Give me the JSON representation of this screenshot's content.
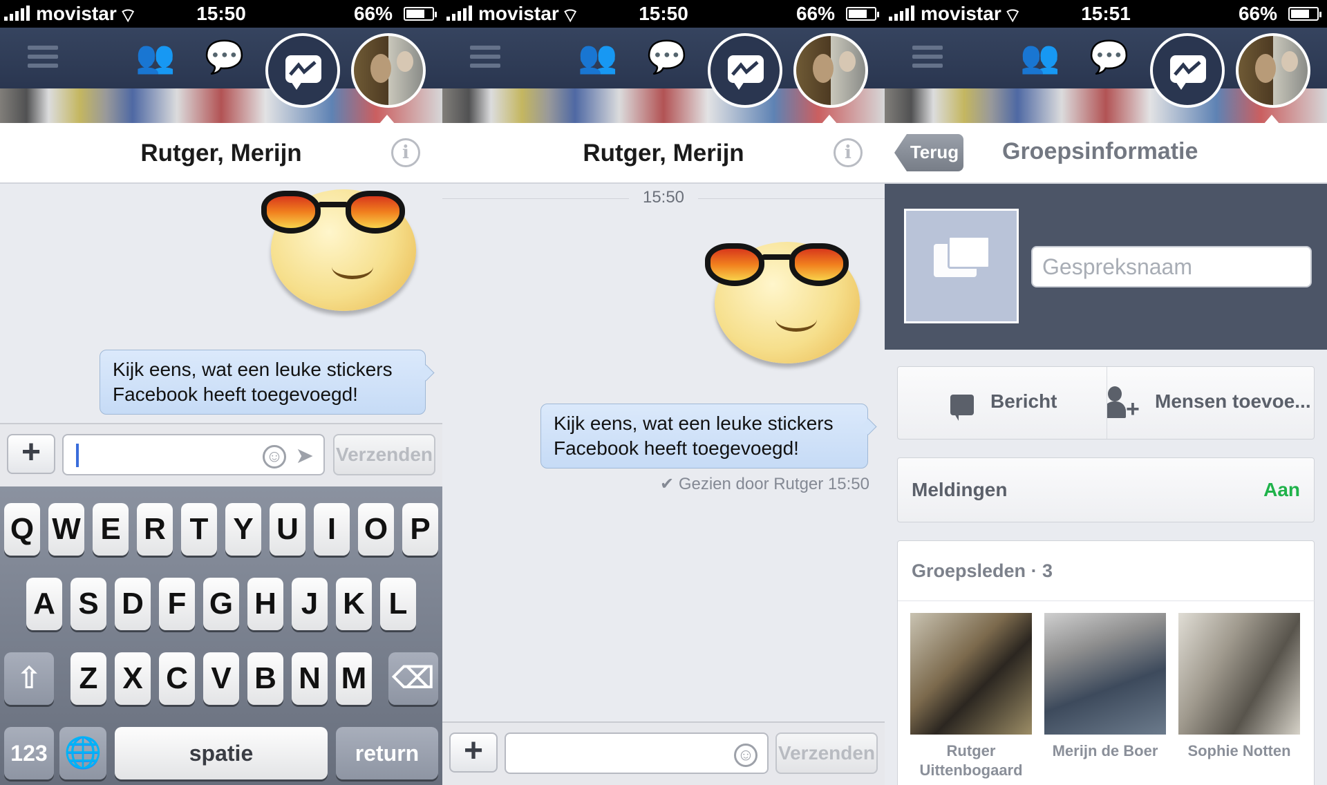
{
  "status_bars": [
    {
      "carrier": "movistar",
      "time": "15:50",
      "battery": "66%",
      "battery_level": 0.66
    },
    {
      "carrier": "movistar",
      "time": "15:50",
      "battery": "66%",
      "battery_level": 0.66
    },
    {
      "carrier": "movistar",
      "time": "15:51",
      "battery": "66%",
      "battery_level": 0.66
    }
  ],
  "nav": {
    "icons": [
      "menu-icon",
      "friends-icon",
      "chat-icon",
      "messenger-icon",
      "group-avatar"
    ]
  },
  "conversation": {
    "title": "Rutger, Merijn",
    "info_glyph": "i",
    "message": "Kijk eens, wat een leuke stickers Facebook heeft toegevoegd!",
    "timestamp": "15:50",
    "seen": "Gezien door Rutger 15:50",
    "sticker": "sunglasses-smiley-sticker"
  },
  "composer": {
    "plus": "+",
    "send": "Verzenden",
    "value": ""
  },
  "keyboard": {
    "row1": [
      "Q",
      "W",
      "E",
      "R",
      "T",
      "Y",
      "U",
      "I",
      "O",
      "P"
    ],
    "row2": [
      "A",
      "S",
      "D",
      "F",
      "G",
      "H",
      "J",
      "K",
      "L"
    ],
    "row3": [
      "Z",
      "X",
      "C",
      "V",
      "B",
      "N",
      "M"
    ],
    "numbers": "123",
    "space": "spatie",
    "return": "return"
  },
  "group_info": {
    "back": "Terug",
    "title": "Groepsinformatie",
    "name_placeholder": "Gespreksnaam",
    "message_action": "Bericht",
    "add_action": "Mensen toevoe...",
    "notifications_label": "Meldingen",
    "notifications_value": "Aan",
    "members_label": "Groepsleden",
    "members_count": "· 3",
    "members": [
      {
        "name_line1": "Rutger",
        "name_line2": "Uittenbogaard"
      },
      {
        "name_line1": "Merijn de Boer",
        "name_line2": ""
      },
      {
        "name_line1": "Sophie Notten",
        "name_line2": ""
      }
    ]
  },
  "colors": {
    "navbar": "#2a3650",
    "bubble": "#cfe0f7",
    "accent_green": "#1fb24a"
  }
}
